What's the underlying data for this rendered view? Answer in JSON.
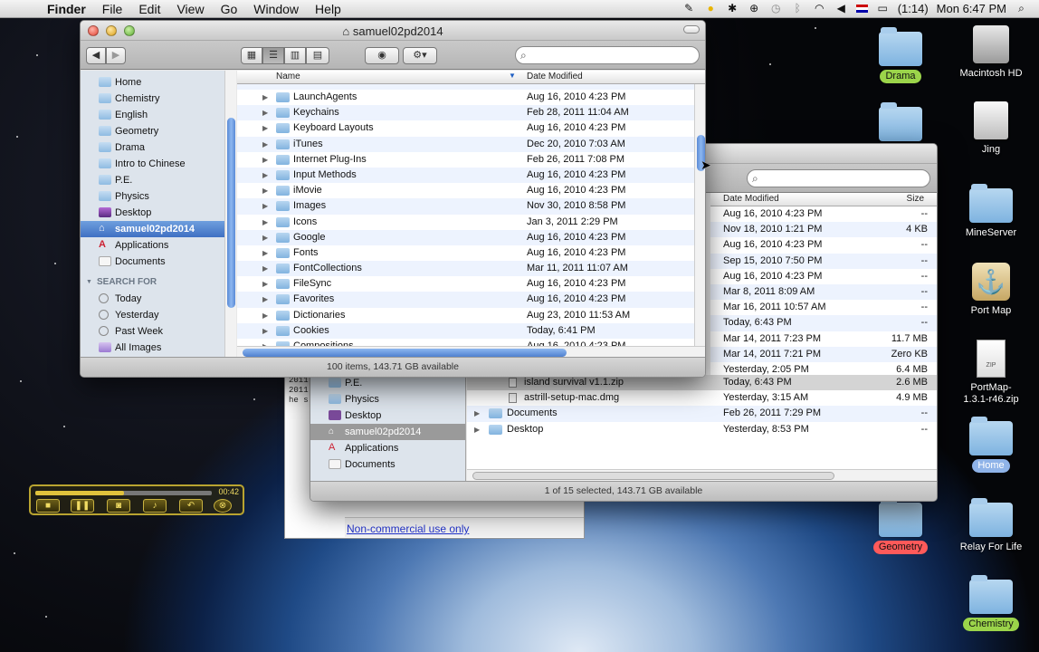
{
  "menubar": {
    "app": "Finder",
    "items": [
      "File",
      "Edit",
      "View",
      "Go",
      "Window",
      "Help"
    ],
    "battery": "(1:14)",
    "clock": "Mon 6:47 PM"
  },
  "desktop_icons": [
    {
      "label": "Drama",
      "style": "green"
    },
    {
      "label": "Macintosh HD",
      "style": "plain"
    },
    {
      "label": "Jing",
      "style": "plain"
    },
    {
      "label": "MineServer",
      "style": "plain"
    },
    {
      "label": "Port Map",
      "style": "plain"
    },
    {
      "label": "PortMap-1.3.1-r46.zip",
      "style": "plain"
    },
    {
      "label": "Home",
      "style": "blue"
    },
    {
      "label": "Geometry",
      "style": "red"
    },
    {
      "label": "Relay For Life",
      "style": "blue"
    },
    {
      "label": "Chemistry",
      "style": "green"
    }
  ],
  "front_window": {
    "title": "samuel02pd2014",
    "sidebar": {
      "places": [
        "Home",
        "Chemistry",
        "English",
        "Geometry",
        "Drama",
        "Intro to Chinese",
        "P.E.",
        "Physics",
        "Desktop",
        "samuel02pd2014",
        "Applications",
        "Documents"
      ],
      "selected": "samuel02pd2014",
      "search_header": "SEARCH FOR",
      "search_items": [
        "Today",
        "Yesterday",
        "Past Week",
        "All Images"
      ]
    },
    "columns": {
      "name": "Name",
      "date": "Date Modified"
    },
    "rows": [
      {
        "name": "LaunchAgents",
        "date": "Aug 16, 2010 4:23 PM"
      },
      {
        "name": "Keychains",
        "date": "Feb 28, 2011 11:04 AM"
      },
      {
        "name": "Keyboard Layouts",
        "date": "Aug 16, 2010 4:23 PM"
      },
      {
        "name": "iTunes",
        "date": "Dec 20, 2010 7:03 AM"
      },
      {
        "name": "Internet Plug-Ins",
        "date": "Feb 26, 2011 7:08 PM"
      },
      {
        "name": "Input Methods",
        "date": "Aug 16, 2010 4:23 PM"
      },
      {
        "name": "iMovie",
        "date": "Aug 16, 2010 4:23 PM"
      },
      {
        "name": "Images",
        "date": "Nov 30, 2010 8:58 PM"
      },
      {
        "name": "Icons",
        "date": "Jan 3, 2011 2:29 PM"
      },
      {
        "name": "Google",
        "date": "Aug 16, 2010 4:23 PM"
      },
      {
        "name": "Fonts",
        "date": "Aug 16, 2010 4:23 PM"
      },
      {
        "name": "FontCollections",
        "date": "Mar 11, 2011 11:07 AM"
      },
      {
        "name": "FileSync",
        "date": "Aug 16, 2010 4:23 PM"
      },
      {
        "name": "Favorites",
        "date": "Aug 16, 2010 4:23 PM"
      },
      {
        "name": "Dictionaries",
        "date": "Aug 23, 2010 11:53 AM"
      },
      {
        "name": "Cookies",
        "date": "Today, 6:41 PM"
      },
      {
        "name": "Compositions",
        "date": "Aug 16, 2010 4:23 PM"
      }
    ],
    "status": "100 items, 143.71 GB available"
  },
  "back_window": {
    "columns": {
      "date": "Date Modified",
      "size": "Size"
    },
    "rows": [
      {
        "date": "Aug 16, 2010 4:23 PM",
        "size": "--"
      },
      {
        "date": "Nov 18, 2010 1:21 PM",
        "size": "4 KB"
      },
      {
        "date": "Aug 16, 2010 4:23 PM",
        "size": "--"
      },
      {
        "date": "Sep 15, 2010 7:50 PM",
        "size": "--"
      },
      {
        "date": "Aug 16, 2010 4:23 PM",
        "size": "--"
      },
      {
        "date": "Mar 8, 2011 8:09 AM",
        "size": "--"
      },
      {
        "date": "Mar 16, 2011 10:57 AM",
        "size": "--"
      },
      {
        "date": "Today, 6:43 PM",
        "size": "--"
      },
      {
        "date": "Mar 14, 2011 7:23 PM",
        "size": "11.7 MB"
      },
      {
        "date": "Mar 14, 2011 7:21 PM",
        "size": "Zero KB"
      },
      {
        "date": "Yesterday, 2:05 PM",
        "size": "6.4 MB"
      }
    ],
    "lower_rows": [
      {
        "name": "island survival v1.1.zip",
        "date": "Today, 6:43 PM",
        "size": "2.6 MB",
        "selected": true
      },
      {
        "name": "astrill-setup-mac.dmg",
        "date": "Yesterday, 3:15 AM",
        "size": "4.9 MB"
      },
      {
        "name": "Documents",
        "date": "Feb 26, 2011 7:29 PM",
        "size": "--",
        "folder": true
      },
      {
        "name": "Desktop",
        "date": "Yesterday, 8:53 PM",
        "size": "--",
        "folder": true
      }
    ],
    "sidebar": [
      "P.E.",
      "Physics",
      "Desktop",
      "samuel02pd2014",
      "Applications",
      "Documents"
    ],
    "selected": "samuel02pd2014",
    "status": "1 of 15 selected, 143.71 GB available"
  },
  "note_window": {
    "lines": [
      "2011",
      "2011",
      "he s"
    ],
    "link": "Non-commercial use only"
  },
  "player": {
    "time": "00:42",
    "progress": 0.5
  }
}
